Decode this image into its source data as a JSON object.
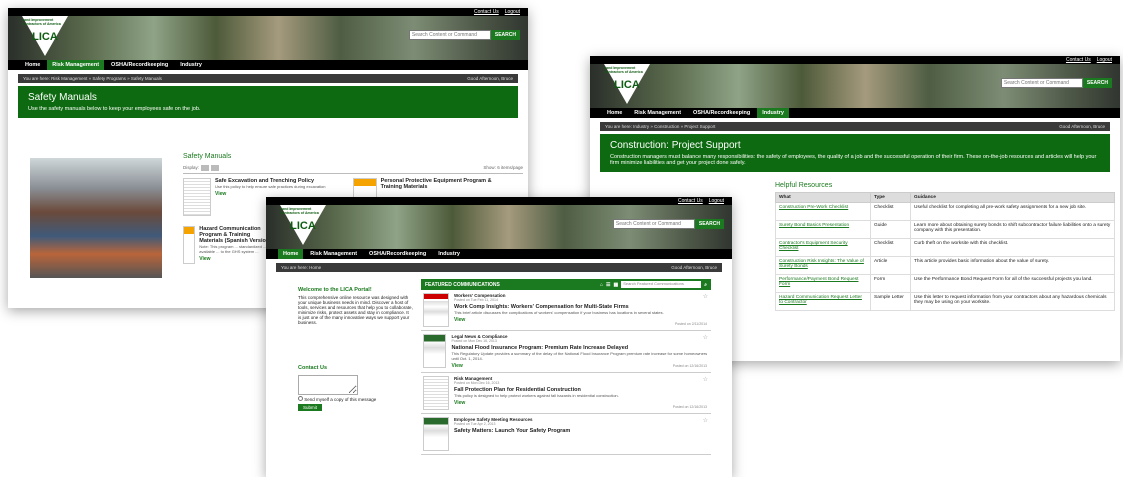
{
  "common": {
    "contact_us": "Contact Us",
    "logout": "Logout",
    "search_placeholder": "Search Content or Command",
    "search_button": "SEARCH",
    "logo_top": "Land Improvement Contractors of America",
    "logo_mid": "LICA",
    "greeting_suffix": "Good Afternoon, Bruce",
    "nav": [
      "Home",
      "Risk Management",
      "OSHA/Recordkeeping",
      "Industry"
    ]
  },
  "s1": {
    "crumb": "You are here: Risk Management » Safety Programs » Safety Manuals",
    "banner_title": "Safety Manuals",
    "banner_text": "Use the safety manuals below to keep your employees safe on the job.",
    "section_title": "Safety Manuals",
    "display_label": "Display:",
    "show_label": "Show:",
    "show_value": "6",
    "items_per_page": "items/page",
    "items": [
      {
        "title": "Safe Excavation and Trenching Policy",
        "desc": "Use this policy to help ensure safe practices during excavation"
      },
      {
        "title": "Personal Protective Equipment Program & Training Materials",
        "desc": ""
      },
      {
        "title": "Hazard Communication Program & Training Materials (Spanish Version)",
        "desc": "Note: This program ... standardized ... available ... to the GHS system ..."
      }
    ],
    "view_label": "View"
  },
  "s2": {
    "crumb": "You are here: Industry » Construction » Project Support",
    "greeting": "Good Afternoon, Bruce",
    "banner_title": "Construction: Project Support",
    "banner_text": "Construction managers must balance many responsibilities: the safety of employees, the quality of a job and the successful operation of their firm. These on-the-job resources and articles will help your firm minimize liabilities and get your project done safely.",
    "section_title": "Helpful Resources",
    "headers": [
      "What",
      "Type",
      "Guidance"
    ],
    "rows": [
      [
        "Construction Pre-Work Checklist",
        "Checklist",
        "Useful checklist for completing all pre-work safety assignments for a new job site."
      ],
      [
        "Surety Bond Basics Presentation",
        "Guide",
        "Learn more about obtaining surety bonds to shift subcontractor failure liabilities onto a surety company with this presentation."
      ],
      [
        "Contractor's Equipment Security Checklist",
        "Checklist",
        "Curb theft on the worksite with this checklist."
      ],
      [
        "Construction Risk Insights: The Value of Surety Bonds",
        "Article",
        "This article provides basic information about the value of surety."
      ],
      [
        "Performance/Payment Bond Request Form",
        "Form",
        "Use the Performance Bond Request Form for all of the successful projects you land."
      ],
      [
        "Hazard Communication Request Letter to Contractor",
        "Sample Letter",
        "Use this letter to request information from your contractors about any hazardous chemicals they may be using on your worksite."
      ]
    ]
  },
  "s3": {
    "crumb": "You are here: Home",
    "welcome_title": "Welcome to the LICA Portal!",
    "welcome_text": "This comprehensive online resource was designed with your unique business needs in mind. Discover a host of tools, services and resources that help you to collaborate, minimize risks, protect assets and stay in compliance. It is just one of the many innovative ways we support your business.",
    "contact_title": "Contact Us",
    "send_copy": "Send myself a copy of this message",
    "submit": "Submit",
    "featured_title": "FEATURED COMMUNICATIONS",
    "featured_search": "Search Featured Communications",
    "items": [
      {
        "cat": "Workers' Compensation",
        "posted": "Posted on Tue Feb 11, 2014",
        "title": "Work Comp Insights: Workers' Compensation for Multi-State Firms",
        "desc": "This brief article discusses the complications of workers' compensation if your business has locations in several states.",
        "pt": "Posted on 2/11/2014"
      },
      {
        "cat": "Legal News & Compliance",
        "posted": "Posted on Mon Dec 16, 2013",
        "title": "National Flood Insurance Program: Premium Rate Increase Delayed",
        "desc": "This Regulatory Update provides a summary of the delay of the National Flood Insurance Program premium rate increase for some homeowners until Oct. 1, 2014.",
        "pt": "Posted on 12/16/2013"
      },
      {
        "cat": "Risk Management",
        "posted": "Posted on Mon Dec 16, 2013",
        "title": "Fall Protection Plan for Residential Construction",
        "desc": "This policy is designed to help protect workers against fall hazards in residential construction.",
        "pt": "Posted on 12/16/2013"
      },
      {
        "cat": "Employee Safety Meeting Resources",
        "posted": "Posted on Tue Apr 2, 2013",
        "title": "Safety Matters: Launch Your Safety Program",
        "desc": "",
        "pt": ""
      }
    ],
    "view_label": "View"
  }
}
